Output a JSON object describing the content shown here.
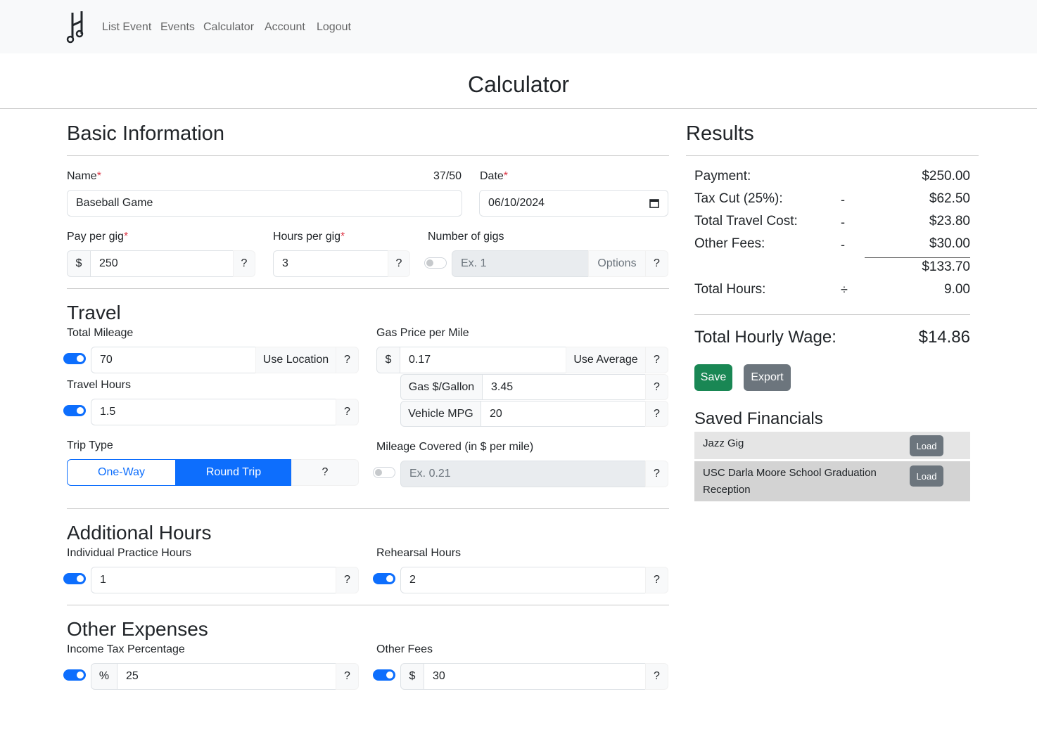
{
  "nav": {
    "links": [
      "List Event",
      "Events",
      "Calculator",
      "Account",
      "Logout"
    ]
  },
  "page_title": "Calculator",
  "basic": {
    "heading": "Basic Information",
    "name_label": "Name",
    "name_counter": "37/50",
    "name_value": "Baseball Game",
    "date_label": "Date",
    "date_value": "06/10/2024",
    "pay_label": "Pay per gig",
    "pay_prefix": "$",
    "pay_value": "250",
    "hours_label": "Hours per gig",
    "hours_value": "3",
    "gigs_label": "Number of gigs",
    "gigs_placeholder": "Ex. 1",
    "gigs_options": "Options",
    "required_mark": "*",
    "help": "?"
  },
  "travel": {
    "heading": "Travel",
    "mileage_label": "Total Mileage",
    "mileage_value": "70",
    "use_location": "Use Location",
    "travel_hours_label": "Travel Hours",
    "travel_hours_value": "1.5",
    "gas_label": "Gas Price per Mile",
    "gas_prefix": "$",
    "gas_value": "0.17",
    "use_average": "Use Average",
    "gas_gallon_label": "Gas $/Gallon",
    "gas_gallon_value": "3.45",
    "mpg_label": "Vehicle MPG",
    "mpg_value": "20",
    "trip_type_label": "Trip Type",
    "one_way": "One-Way",
    "round_trip": "Round Trip",
    "mileage_covered_label": "Mileage Covered (in $ per mile)",
    "mileage_covered_placeholder": "Ex. 0.21"
  },
  "additional": {
    "heading": "Additional Hours",
    "practice_label": "Individual Practice Hours",
    "practice_value": "1",
    "rehearsal_label": "Rehearsal Hours",
    "rehearsal_value": "2"
  },
  "expenses": {
    "heading": "Other Expenses",
    "tax_label": "Income Tax Percentage",
    "tax_prefix": "%",
    "tax_value": "25",
    "fees_label": "Other Fees",
    "fees_prefix": "$",
    "fees_value": "30"
  },
  "results": {
    "heading": "Results",
    "rows": [
      {
        "label": "Payment:",
        "op": "",
        "value": "$250.00"
      },
      {
        "label": "Tax Cut (25%):",
        "op": "-",
        "value": "$62.50"
      },
      {
        "label": "Total Travel Cost:",
        "op": "-",
        "value": "$23.80"
      },
      {
        "label": "Other Fees:",
        "op": "-",
        "value": "$30.00"
      }
    ],
    "subtotal": "$133.70",
    "hours_label": "Total Hours:",
    "hours_op": "÷",
    "hours_value": "9.00",
    "wage_label": "Total Hourly Wage:",
    "wage_value": "$14.86",
    "save": "Save",
    "export": "Export",
    "saved_heading": "Saved Financials",
    "saved": [
      {
        "name": "Jazz Gig",
        "load": "Load"
      },
      {
        "name": "USC Darla Moore School Graduation Reception",
        "load": "Load"
      }
    ]
  },
  "colors": {
    "primary": "#0d6efd",
    "success": "#198754",
    "secondary": "#6c757d",
    "danger": "#dc3545"
  }
}
